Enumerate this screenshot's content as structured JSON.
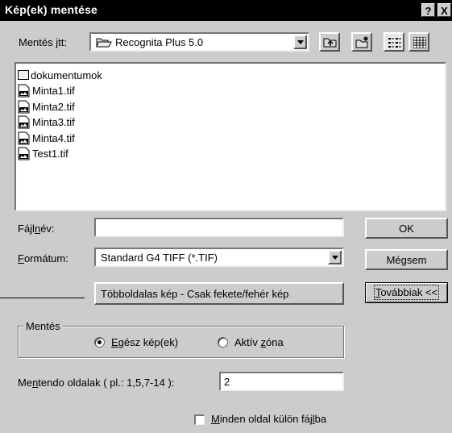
{
  "window": {
    "title": "Kép(ek) mentése",
    "help_label": "?",
    "close_label": "X"
  },
  "save_in": {
    "label_pre": "Mentés ",
    "label_key": "j",
    "label_post": "tt:",
    "folder": "Recognita Plus 5.0"
  },
  "toolbar": {
    "up_folder_icon": "up-folder-icon",
    "new_folder_icon": "new-folder-icon",
    "list_view_icon": "list-view-icon",
    "details_view_icon": "details-view-icon"
  },
  "files": [
    {
      "name": "dokumentumok",
      "type": "folder"
    },
    {
      "name": "Minta1.tif",
      "type": "tif"
    },
    {
      "name": "Minta2.tif",
      "type": "tif"
    },
    {
      "name": "Minta3.tif",
      "type": "tif"
    },
    {
      "name": "Minta4.tif",
      "type": "tif"
    },
    {
      "name": "Test1.tif",
      "type": "tif"
    }
  ],
  "filename": {
    "label_pre": "Fájl",
    "label_key": "n",
    "label_post": "év:",
    "value": ""
  },
  "format": {
    "label_key": "F",
    "label_post": "ormátum:",
    "selected": "Standard G4 TIFF (*.TIF)"
  },
  "info_text": "Többoldalas kép  -  Csak fekete/fehér kép",
  "buttons": {
    "ok": "OK",
    "cancel": "Mégsem",
    "more": "Továbbiak <<",
    "more_key": "T",
    "more_rest": "ovábbiak <<"
  },
  "save_group": {
    "title": "Mentés",
    "whole_key": "E",
    "whole_rest": "gész kép(ek)",
    "active_pre": "Aktív ",
    "active_key": "z",
    "active_post": "óna",
    "selected": "whole"
  },
  "pages": {
    "label_pre": "Me",
    "label_key": "n",
    "label_post": "tendo oldalak  ( pl.: 1,5,7-14 ):",
    "value": "2"
  },
  "separate": {
    "label_key": "M",
    "label_pre": "inden oldal külön fáj",
    "label_key2": "l",
    "label_post": "ba",
    "checked": false
  }
}
